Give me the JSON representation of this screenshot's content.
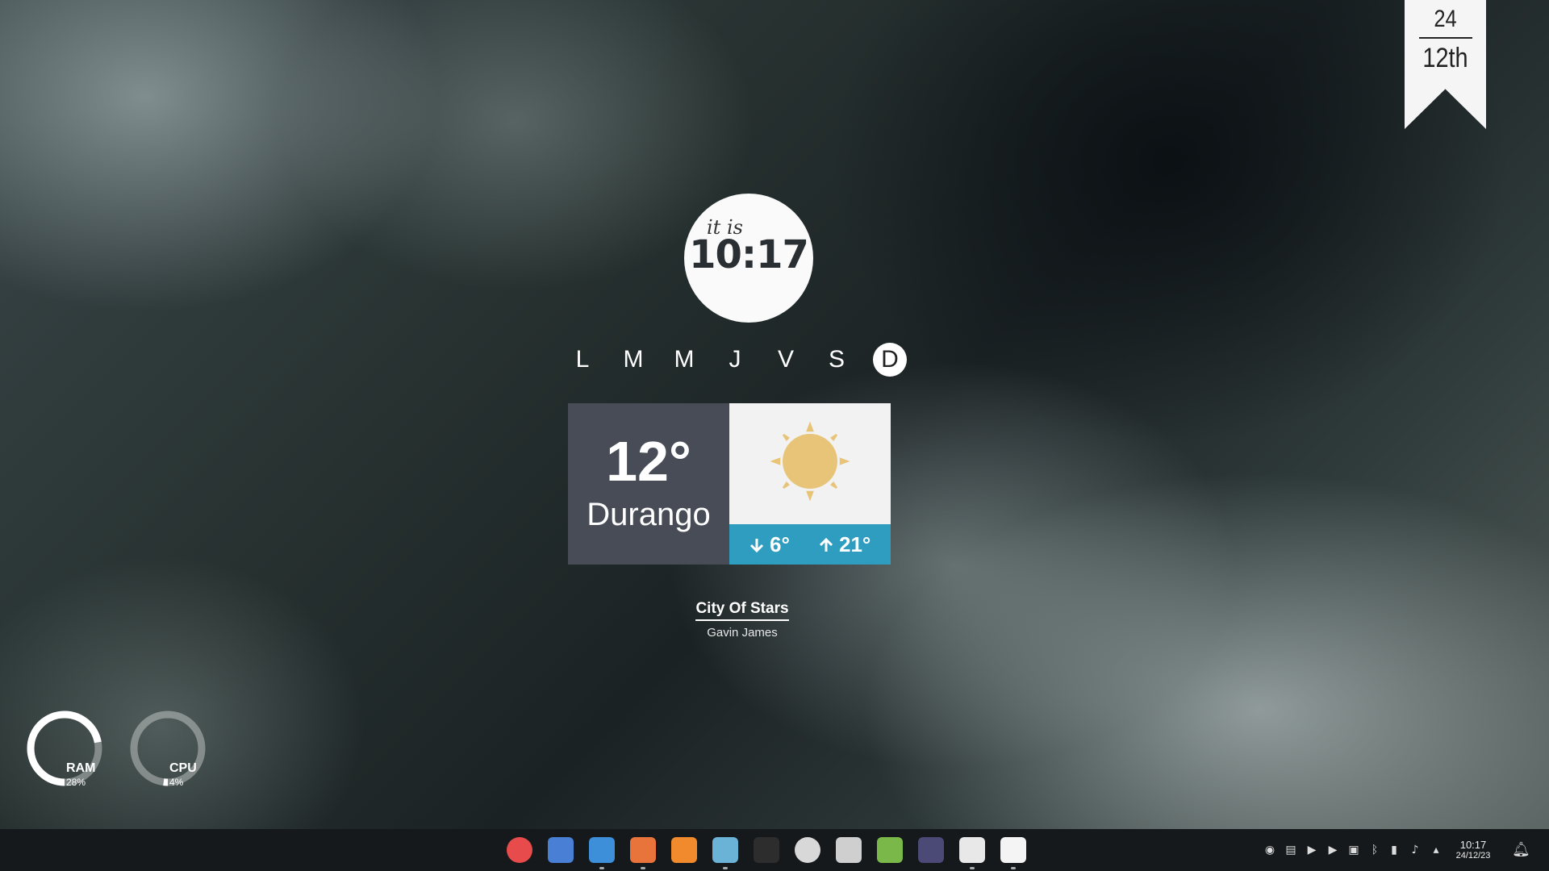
{
  "date_tag": {
    "day": "24",
    "month": "12th"
  },
  "clock": {
    "prefix": "it is",
    "time": "10:17"
  },
  "weekdays": [
    {
      "label": "L",
      "active": false
    },
    {
      "label": "M",
      "active": false
    },
    {
      "label": "M",
      "active": false
    },
    {
      "label": "J",
      "active": false
    },
    {
      "label": "V",
      "active": false
    },
    {
      "label": "S",
      "active": false
    },
    {
      "label": "D",
      "active": true
    }
  ],
  "weather": {
    "temperature": "12°",
    "city": "Durango",
    "condition_icon": "sun-icon",
    "low": "6°",
    "high": "21°",
    "colors": {
      "left_panel": "#474c57",
      "range_bar": "#2e9dbf",
      "sun": "#e8c479"
    }
  },
  "now_playing": {
    "title": "City Of Stars",
    "artist": "Gavin James"
  },
  "gauges": [
    {
      "label": "RAM",
      "value_text": "28%",
      "value": 0.28
    },
    {
      "label": "CPU",
      "value_text": "4%",
      "value": 0.04
    }
  ],
  "dock": [
    {
      "name": "launcher-icon",
      "color": "#e84b4b"
    },
    {
      "name": "workspace-icon",
      "color": "#4a7fd6"
    },
    {
      "name": "files-icon",
      "color": "#3d8fd9"
    },
    {
      "name": "firefox-icon",
      "color": "#e8743b"
    },
    {
      "name": "app-store-icon",
      "color": "#f08a2c"
    },
    {
      "name": "image-viewer-icon",
      "color": "#6bb3d6"
    },
    {
      "name": "terminal-icon",
      "color": "#2d2d2d"
    },
    {
      "name": "settings-icon",
      "color": "#d8d8d8"
    },
    {
      "name": "text-editor-icon",
      "color": "#cfcfcf"
    },
    {
      "name": "spotify-icon",
      "color": "#7ab84a"
    },
    {
      "name": "code-editor-icon",
      "color": "#4b4a77"
    },
    {
      "name": "notes-icon",
      "color": "#e8e8e8"
    },
    {
      "name": "clock-app-icon",
      "color": "#f4f4f4"
    }
  ],
  "tray": {
    "icons": [
      "steam-icon",
      "clipboard-icon",
      "play-icon",
      "play-icon",
      "screen-icon",
      "bluetooth-icon",
      "battery-icon",
      "volume-icon",
      "chevron-up-icon"
    ],
    "time": "10:17",
    "date": "24/12/23",
    "notification_icon": "bell-icon"
  }
}
